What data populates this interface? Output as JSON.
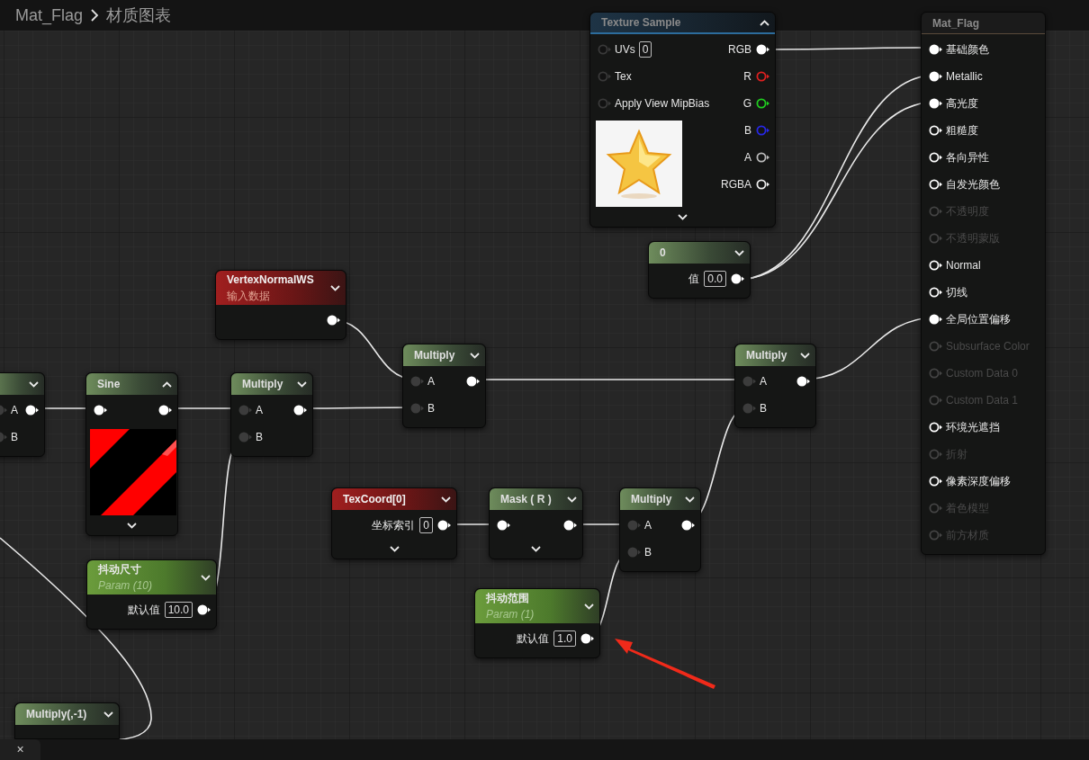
{
  "breadcrumb": {
    "asset": "Mat_Flag",
    "page": "材质图表"
  },
  "nodes": [
    {
      "kind": "texture",
      "title": "Texture Sample",
      "expanded": true,
      "advanced": true,
      "preview": true,
      "inputs": [
        {
          "label": "UVs",
          "field": "0",
          "kind": "darkring"
        },
        {
          "label": "Tex",
          "kind": "darkring"
        },
        {
          "label": "Apply View MipBias",
          "kind": "darkring"
        }
      ],
      "outputs": [
        {
          "label": "RGB",
          "kind": "solid"
        },
        {
          "label": "R",
          "kind": "ring",
          "color": "#e02020"
        },
        {
          "label": "G",
          "kind": "ring",
          "color": "#20d020"
        },
        {
          "label": "B",
          "kind": "ring",
          "color": "#2828e8"
        },
        {
          "label": "A",
          "kind": "ring",
          "color": "#bbbbbb"
        },
        {
          "label": "RGBA",
          "kind": "ring",
          "color": "#eeeeee"
        }
      ]
    },
    {
      "kind": "output",
      "title": "Mat_Flag",
      "inputs": [
        {
          "label": "基础颜色",
          "kind": "solid",
          "disabled": false
        },
        {
          "label": "Metallic",
          "kind": "solid",
          "disabled": false
        },
        {
          "label": "高光度",
          "kind": "solid",
          "disabled": false
        },
        {
          "label": "粗糙度",
          "kind": "ring",
          "disabled": false
        },
        {
          "label": "各向异性",
          "kind": "ring",
          "disabled": false
        },
        {
          "label": "自发光颜色",
          "kind": "ring",
          "disabled": false
        },
        {
          "label": "不透明度",
          "kind": "ring",
          "disabled": true
        },
        {
          "label": "不透明蒙版",
          "kind": "ring",
          "disabled": true
        },
        {
          "label": "Normal",
          "kind": "ring",
          "disabled": false
        },
        {
          "label": "切线",
          "kind": "ring",
          "disabled": false
        },
        {
          "label": "全局位置偏移",
          "kind": "solid",
          "disabled": false
        },
        {
          "label": "Subsurface Color",
          "kind": "ring",
          "disabled": true
        },
        {
          "label": "Custom Data 0",
          "kind": "ring",
          "disabled": true
        },
        {
          "label": "Custom Data 1",
          "kind": "ring",
          "disabled": true
        },
        {
          "label": "环境光遮挡",
          "kind": "ring",
          "disabled": false
        },
        {
          "label": "折射",
          "kind": "ring",
          "disabled": true
        },
        {
          "label": "像素深度偏移",
          "kind": "ring",
          "disabled": false
        },
        {
          "label": "着色模型",
          "kind": "ring",
          "disabled": true
        },
        {
          "label": "前方材质",
          "kind": "ring",
          "disabled": true
        }
      ]
    },
    {
      "kind": "math",
      "title": "0",
      "expanded": false,
      "outputs": [
        {
          "label": "值",
          "field": "0.0",
          "kind": "solid"
        }
      ]
    },
    {
      "kind": "input",
      "title": "VertexNormalWS",
      "subtitle": "输入数据",
      "expanded": false,
      "outputs": [
        {
          "kind": "solid"
        }
      ]
    },
    {
      "kind": "math",
      "title": "Multiply",
      "expanded": false,
      "inputs": [
        {
          "label": "A",
          "kind": "dark"
        },
        {
          "label": "B",
          "kind": "dark"
        }
      ],
      "outputs": [
        {
          "kind": "solid"
        }
      ]
    },
    {
      "kind": "math",
      "title": "Multiply",
      "expanded": false,
      "inputs": [
        {
          "label": "A",
          "kind": "dark"
        },
        {
          "label": "B",
          "kind": "dark"
        }
      ],
      "outputs": [
        {
          "kind": "solid"
        }
      ]
    },
    {
      "kind": "math",
      "expanded": false,
      "inputs": [
        {
          "label": "A",
          "kind": "dark"
        },
        {
          "label": "B",
          "kind": "dark"
        }
      ],
      "outputs": [
        {
          "kind": "solid"
        }
      ]
    },
    {
      "kind": "math",
      "title": "Sine",
      "expanded": true,
      "advanced": true,
      "preview": true,
      "inputs": [
        {
          "kind": "solid"
        }
      ],
      "outputs": [
        {
          "kind": "solid"
        }
      ]
    },
    {
      "kind": "math",
      "title": "Multiply",
      "expanded": false,
      "inputs": [
        {
          "label": "A",
          "kind": "dark"
        },
        {
          "label": "B",
          "kind": "dark"
        }
      ],
      "outputs": [
        {
          "kind": "solid"
        }
      ]
    },
    {
      "kind": "param",
      "title": "抖动尺寸",
      "subtitle": "Param (10)",
      "expanded": false,
      "outputs": [
        {
          "label": "默认值",
          "field": "10.0",
          "kind": "solid"
        }
      ]
    },
    {
      "kind": "input",
      "title": "TexCoord[0]",
      "expanded": false,
      "advanced": true,
      "outputs": [
        {
          "label": "坐标索引",
          "field": "0",
          "kind": "solid"
        }
      ]
    },
    {
      "kind": "math",
      "title": "Mask ( R )",
      "expanded": false,
      "advanced": true,
      "inputs": [
        {
          "kind": "solid"
        }
      ],
      "outputs": [
        {
          "kind": "solid"
        }
      ]
    },
    {
      "kind": "math",
      "title": "Multiply",
      "expanded": false,
      "inputs": [
        {
          "label": "A",
          "kind": "dark"
        },
        {
          "label": "B",
          "kind": "dark"
        }
      ],
      "outputs": [
        {
          "kind": "solid"
        }
      ]
    },
    {
      "kind": "param",
      "title": "抖动范围",
      "subtitle": "Param (1)",
      "expanded": false,
      "outputs": [
        {
          "label": "默认值",
          "field": "1.0",
          "kind": "solid"
        }
      ]
    },
    {
      "kind": "math",
      "title": "Multiply(,-1)",
      "expanded": false
    }
  ],
  "bottom_tab": {
    "close": "×"
  }
}
